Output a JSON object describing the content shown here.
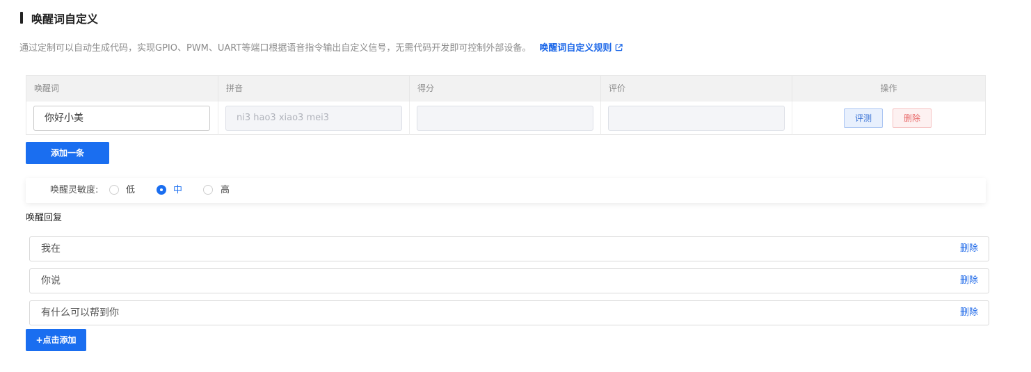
{
  "header": {
    "title": "唤醒词自定义",
    "description": "通过定制可以自动生成代码，实现GPIO、PWM、UART等端口根据语音指令输出自定义信号，无需代码开发即可控制外部设备。",
    "rule_link": "唤醒词自定义规则",
    "link_icon": "external-link-icon"
  },
  "table": {
    "headers": [
      "唤醒词",
      "拼音",
      "得分",
      "评价",
      "操作"
    ],
    "rows": [
      {
        "wake_word": "你好小美",
        "pinyin": "ni3 hao3 xiao3 mei3",
        "score": "",
        "evaluation": "",
        "eval_button": "评测",
        "delete_button": "删除"
      }
    ]
  },
  "add_row_button": "添加一条",
  "sensitivity": {
    "label": "唤醒灵敏度:",
    "options": [
      "低",
      "中",
      "高"
    ],
    "selected": "中"
  },
  "reply": {
    "title": "唤醒回复",
    "items": [
      {
        "text": "我在",
        "delete_label": "删除"
      },
      {
        "text": "你说",
        "delete_label": "删除"
      },
      {
        "text": "有什么可以帮到你",
        "delete_label": "删除"
      }
    ],
    "add_button": "+点击添加"
  },
  "colors": {
    "primary": "#1a6ef0",
    "link": "#1a66e8",
    "danger": "#e86a6a"
  }
}
